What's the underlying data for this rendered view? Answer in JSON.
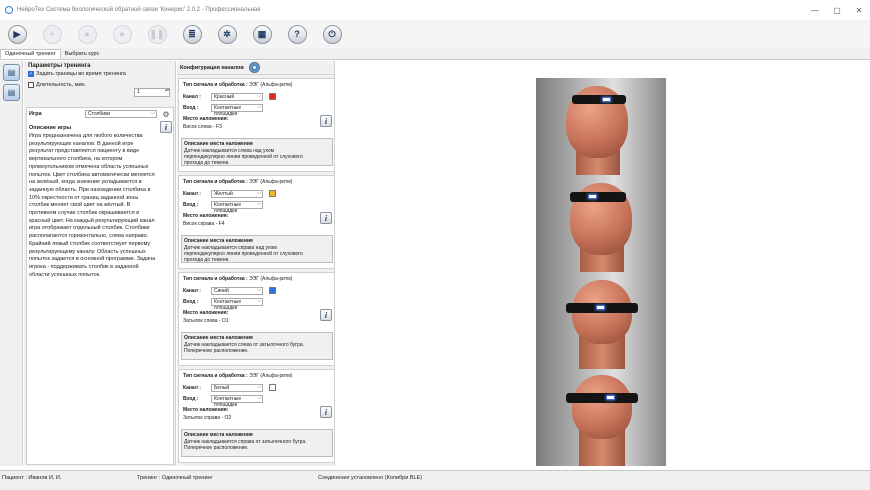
{
  "window": {
    "title": "НейроТех Система биологической обратной связи 'Кинерис' 2.0.2 - Профессиональная",
    "min": "—",
    "max": "▢",
    "close": "✕"
  },
  "toolbar": {
    "play": "▶",
    "add": "+",
    "pause_circle": "●",
    "record": "●",
    "pause": "❚❚",
    "database": "≣",
    "settings": "✲",
    "chart": "▦",
    "help": "?",
    "power": "⏻"
  },
  "tabs": [
    "Одиночный тренинг",
    "Выбрать курс"
  ],
  "training": {
    "title": "Параметры тренинга",
    "set_bounds": "Задать границы во время тренинга",
    "set_bounds_checked": true,
    "duration_label": "Длительность, мин.",
    "duration_checked": false,
    "duration_value": "1"
  },
  "game": {
    "label": "Игра",
    "selected": "Столбики",
    "desc_title": "Описание игры",
    "description": "Игра предназначена для любого количества результирующих каналов. В данной игре результат представляется пациенту в виде вертикального столбика, на котором прямоугольником отмечена область успешных попыток. Цвет столбика автоматически меняется на зелёный, когда значение укладывается в заданную область. При нахождении столбика в 10% окрестности от границ заданной зоны столбик меняет свой цвет на жёлтый. В противном случае столбик окрашивается в красный цвет. На каждый результирующий канал игра отображает отдельный столбик. Столбики располагаются горизонтально, слева направо. Крайний левый столбик соответствует первому результирующему каналу. Область успешных попыток задается в основной программе. Задача игрока - поддерживать столбик в заданной области успешных попыток."
  },
  "channels_title": "Конфигурация каналов",
  "channel_labels": {
    "type": "Тип сигнала и обработка :",
    "channel": "Канал :",
    "input": "Вход :",
    "place": "Место наложения:",
    "desc": "Описание места наложения"
  },
  "channels": [
    {
      "type": "ЭЭГ (Альфа-ритм)",
      "channel": "Красный",
      "color": "#e8231f",
      "input": "Контактные площадки",
      "place": "Висок слева - F3",
      "desc": "Датчик накладывается слева над ухом перпендикулярно линии проведенной от слухового прохода до темени."
    },
    {
      "type": "ЭЭГ (Альфа-ритм)",
      "channel": "Желтый",
      "color": "#f2b428",
      "input": "Контактные площадки",
      "place": "Висок справа - F4",
      "desc": "Датчик накладывается справа над ухом перпендикулярно линии проведенной от слухового прохода до темени."
    },
    {
      "type": "ЭЭГ (Альфа-ритм)",
      "channel": "Синий",
      "color": "#2a73e0",
      "input": "Контактные площадки",
      "place": "Затылок слева - O1",
      "desc": "Датчик накладывается слева от затылочного бугра. Поперечное расположение."
    },
    {
      "type": "ЭЭГ (Альфа-ритм)",
      "channel": "Белый",
      "color": "#ffffff",
      "input": "Контактные площадки",
      "place": "Затылок справа - O2",
      "desc": "Датчик накладывается справа от затылочного бугра. Поперечное расположение."
    }
  ],
  "status": {
    "patient": "Пациент : Иванов И. И.",
    "training": "Тренинг : Одиночный тренинг",
    "connection": "Соединение установлено (Колибри BLE)"
  }
}
